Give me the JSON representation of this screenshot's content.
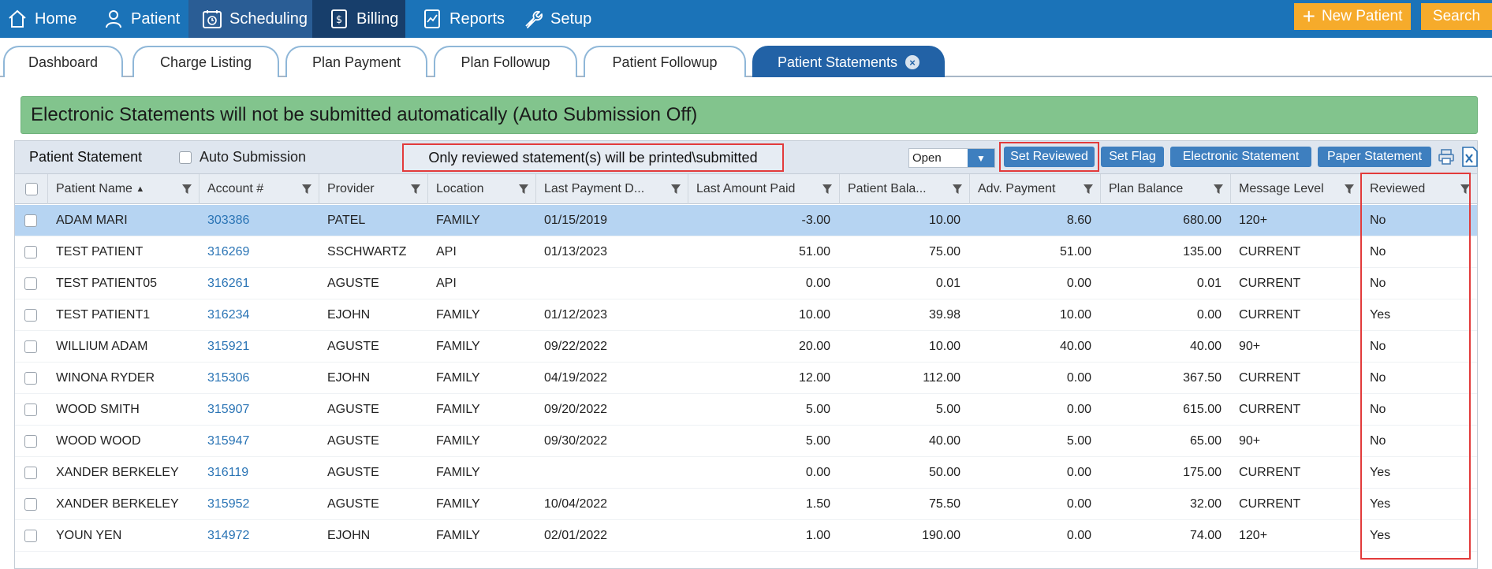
{
  "nav": {
    "home": "Home",
    "patient": "Patient",
    "scheduling": "Scheduling",
    "billing": "Billing",
    "reports": "Reports",
    "setup": "Setup",
    "new_patient": "New Patient",
    "search": "Search"
  },
  "tabs": [
    "Dashboard",
    "Charge Listing",
    "Plan Payment",
    "Plan Followup",
    "Patient Followup",
    "Patient Statements"
  ],
  "banner": "Electronic Statements will not be submitted automatically (Auto Submission Off)",
  "toolbar": {
    "title": "Patient Statement",
    "auto_submission": "Auto Submission",
    "notice": "Only reviewed statement(s) will be printed\\submitted",
    "status": "Open",
    "set_reviewed": "Set Reviewed",
    "set_flag": "Set Flag",
    "electronic_statement": "Electronic Statement",
    "paper_statement": "Paper Statement"
  },
  "columns": [
    "Patient Name",
    "Account #",
    "Provider",
    "Location",
    "Last Payment D...",
    "Last Amount Paid",
    "Patient Bala...",
    "Adv. Payment",
    "Plan Balance",
    "Message Level",
    "Reviewed"
  ],
  "sort_indicator": "▲",
  "rows": [
    [
      "ADAM MARI",
      "303386",
      "PATEL",
      "FAMILY",
      "01/15/2019",
      "-3.00",
      "10.00",
      "8.60",
      "680.00",
      "120+",
      "No"
    ],
    [
      "TEST PATIENT",
      "316269",
      "SSCHWARTZ",
      "API",
      "01/13/2023",
      "51.00",
      "75.00",
      "51.00",
      "135.00",
      "CURRENT",
      "No"
    ],
    [
      "TEST PATIENT05",
      "316261",
      "AGUSTE",
      "API",
      "",
      "0.00",
      "0.01",
      "0.00",
      "0.01",
      "CURRENT",
      "No"
    ],
    [
      "TEST PATIENT1",
      "316234",
      "EJOHN",
      "FAMILY",
      "01/12/2023",
      "10.00",
      "39.98",
      "10.00",
      "0.00",
      "CURRENT",
      "Yes"
    ],
    [
      "WILLIUM ADAM",
      "315921",
      "AGUSTE",
      "FAMILY",
      "09/22/2022",
      "20.00",
      "10.00",
      "40.00",
      "40.00",
      "90+",
      "No"
    ],
    [
      "WINONA RYDER",
      "315306",
      "EJOHN",
      "FAMILY",
      "04/19/2022",
      "12.00",
      "112.00",
      "0.00",
      "367.50",
      "CURRENT",
      "No"
    ],
    [
      "WOOD SMITH",
      "315907",
      "AGUSTE",
      "FAMILY",
      "09/20/2022",
      "5.00",
      "5.00",
      "0.00",
      "615.00",
      "CURRENT",
      "No"
    ],
    [
      "WOOD WOOD",
      "315947",
      "AGUSTE",
      "FAMILY",
      "09/30/2022",
      "5.00",
      "40.00",
      "5.00",
      "65.00",
      "90+",
      "No"
    ],
    [
      "XANDER BERKELEY",
      "316119",
      "AGUSTE",
      "FAMILY",
      "",
      "0.00",
      "50.00",
      "0.00",
      "175.00",
      "CURRENT",
      "Yes"
    ],
    [
      "XANDER BERKELEY",
      "315952",
      "AGUSTE",
      "FAMILY",
      "10/04/2022",
      "1.50",
      "75.50",
      "0.00",
      "32.00",
      "CURRENT",
      "Yes"
    ],
    [
      "YOUN YEN",
      "314972",
      "EJOHN",
      "FAMILY",
      "02/01/2022",
      "1.00",
      "190.00",
      "0.00",
      "74.00",
      "120+",
      "Yes"
    ]
  ]
}
